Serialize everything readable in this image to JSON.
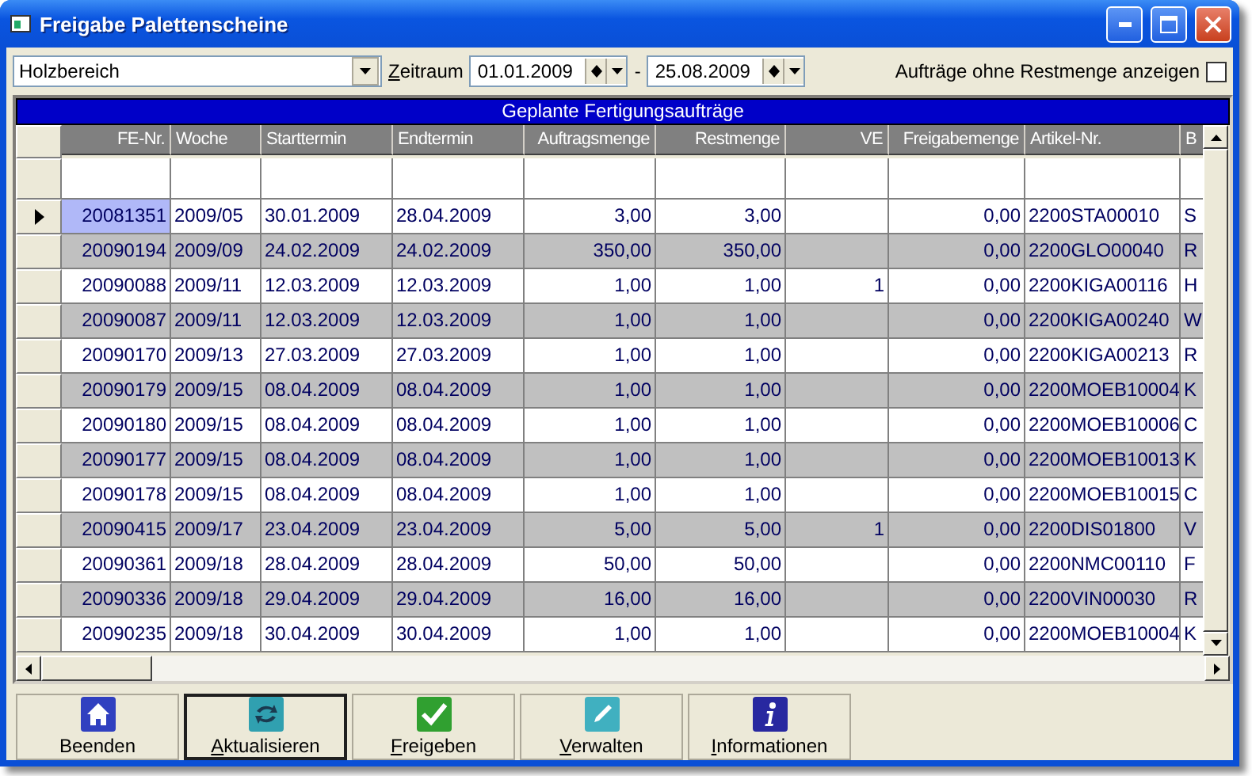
{
  "window": {
    "title": "Freigabe Palettenscheine"
  },
  "filter": {
    "area": "Holzbereich",
    "period_label": "Zeitraum",
    "date_from": "01.01.2009",
    "separator": "-",
    "date_to": "25.08.2009",
    "option_label": "Aufträge ohne Restmenge anzeigen",
    "option_checked": false
  },
  "grid": {
    "title": "Geplante Fertigungsaufträge",
    "columns": [
      {
        "label": "FE-Nr."
      },
      {
        "label": "Woche"
      },
      {
        "label": "Starttermin"
      },
      {
        "label": "Endtermin"
      },
      {
        "label": "Auftragsmenge"
      },
      {
        "label": "Restmenge"
      },
      {
        "label": "VE"
      },
      {
        "label": "Freigabemenge"
      },
      {
        "label": "Artikel-Nr."
      },
      {
        "label": "B"
      }
    ],
    "rows": [
      {
        "current": true,
        "cells": [
          "20081351",
          "2009/05",
          "30.01.2009",
          "28.04.2009",
          "3,00",
          "3,00",
          "",
          "0,00",
          "2200STA00010",
          "S"
        ]
      },
      {
        "current": false,
        "cells": [
          "20090194",
          "2009/09",
          "24.02.2009",
          "24.02.2009",
          "350,00",
          "350,00",
          "",
          "0,00",
          "2200GLO00040",
          "R"
        ]
      },
      {
        "current": false,
        "cells": [
          "20090088",
          "2009/11",
          "12.03.2009",
          "12.03.2009",
          "1,00",
          "1,00",
          "1",
          "0,00",
          "2200KIGA00116",
          "H"
        ]
      },
      {
        "current": false,
        "cells": [
          "20090087",
          "2009/11",
          "12.03.2009",
          "12.03.2009",
          "1,00",
          "1,00",
          "",
          "0,00",
          "2200KIGA00240",
          "W"
        ]
      },
      {
        "current": false,
        "cells": [
          "20090170",
          "2009/13",
          "27.03.2009",
          "27.03.2009",
          "1,00",
          "1,00",
          "",
          "0,00",
          "2200KIGA00213",
          "R"
        ]
      },
      {
        "current": false,
        "cells": [
          "20090179",
          "2009/15",
          "08.04.2009",
          "08.04.2009",
          "1,00",
          "1,00",
          "",
          "0,00",
          "2200MOEB10004",
          "K"
        ]
      },
      {
        "current": false,
        "cells": [
          "20090180",
          "2009/15",
          "08.04.2009",
          "08.04.2009",
          "1,00",
          "1,00",
          "",
          "0,00",
          "2200MOEB10006",
          "C"
        ]
      },
      {
        "current": false,
        "cells": [
          "20090177",
          "2009/15",
          "08.04.2009",
          "08.04.2009",
          "1,00",
          "1,00",
          "",
          "0,00",
          "2200MOEB10013",
          "K"
        ]
      },
      {
        "current": false,
        "cells": [
          "20090178",
          "2009/15",
          "08.04.2009",
          "08.04.2009",
          "1,00",
          "1,00",
          "",
          "0,00",
          "2200MOEB10015",
          "C"
        ]
      },
      {
        "current": false,
        "cells": [
          "20090415",
          "2009/17",
          "23.04.2009",
          "23.04.2009",
          "5,00",
          "5,00",
          "1",
          "0,00",
          "2200DIS01800",
          "V"
        ]
      },
      {
        "current": false,
        "cells": [
          "20090361",
          "2009/18",
          "28.04.2009",
          "28.04.2009",
          "50,00",
          "50,00",
          "",
          "0,00",
          "2200NMC00110",
          "F"
        ]
      },
      {
        "current": false,
        "cells": [
          "20090336",
          "2009/18",
          "29.04.2009",
          "29.04.2009",
          "16,00",
          "16,00",
          "",
          "0,00",
          "2200VIN00030",
          "R"
        ]
      },
      {
        "current": false,
        "cells": [
          "20090235",
          "2009/18",
          "30.04.2009",
          "30.04.2009",
          "1,00",
          "1,00",
          "",
          "0,00",
          "2200MOEB10004",
          "K"
        ]
      }
    ]
  },
  "buttons": [
    {
      "label": "Beenden",
      "kind": "home",
      "mnemonic": false,
      "focused": false
    },
    {
      "label": "Aktualisieren",
      "kind": "refresh",
      "mnemonic": true,
      "focused": true
    },
    {
      "label": "Freigeben",
      "kind": "check",
      "mnemonic": true,
      "focused": false
    },
    {
      "label": "Verwalten",
      "kind": "edit",
      "mnemonic": true,
      "focused": false
    },
    {
      "label": "Informationen",
      "kind": "info",
      "mnemonic": true,
      "focused": false
    }
  ]
}
